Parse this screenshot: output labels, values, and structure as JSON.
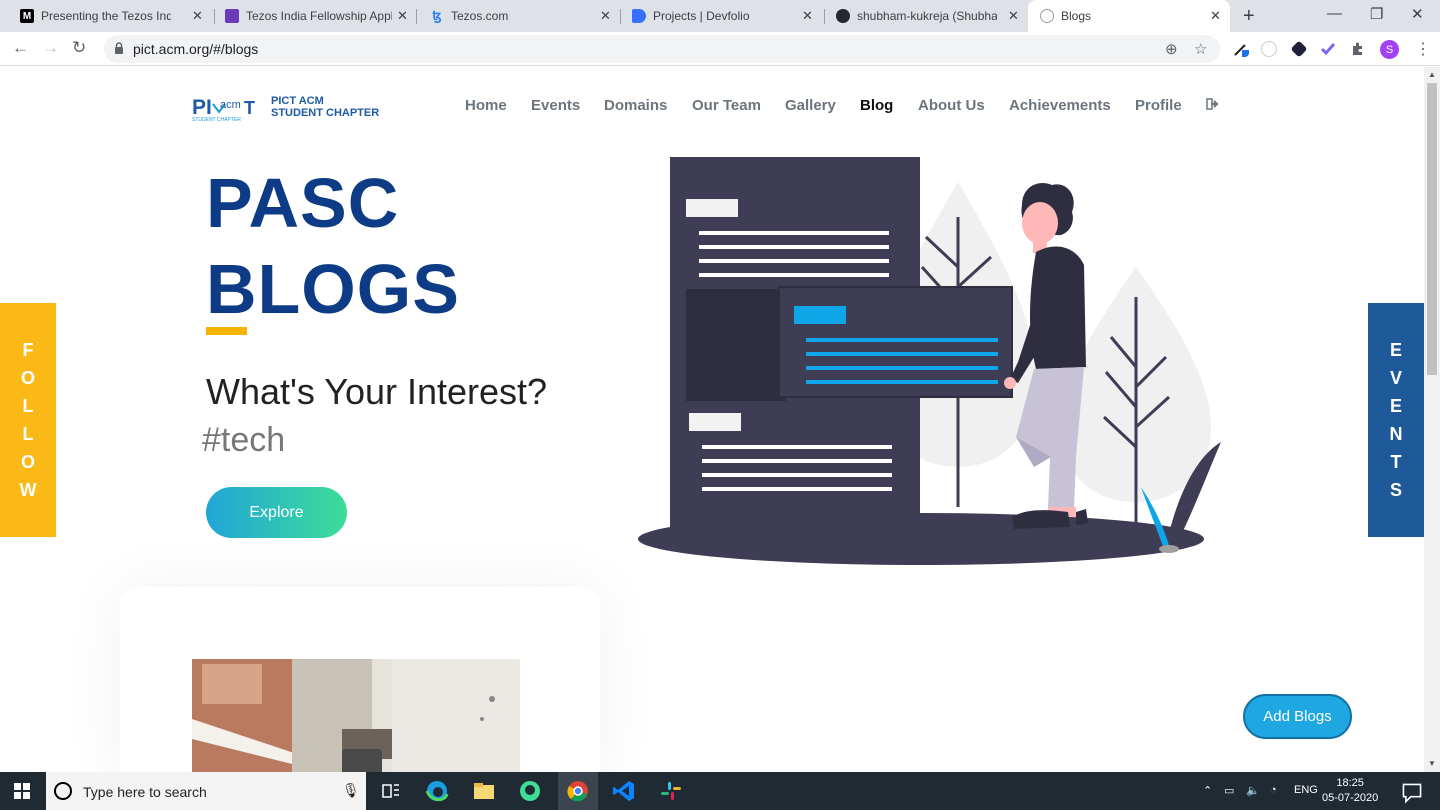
{
  "browser": {
    "tabs": [
      {
        "title": "Presenting the Tezos India Fe",
        "favicon": "M"
      },
      {
        "title": "Tezos India Fellowship Applic",
        "favicon": "forms-icon"
      },
      {
        "title": "Tezos.com",
        "favicon": "tezos-icon"
      },
      {
        "title": "Projects | Devfolio",
        "favicon": "devfolio-icon"
      },
      {
        "title": "shubham-kukreja (Shubham",
        "favicon": "github-icon"
      },
      {
        "title": "Blogs",
        "favicon": "globe-icon",
        "active": true
      }
    ],
    "url": "pict.acm.org/#/blogs",
    "profile_initial": "S"
  },
  "site": {
    "logo_text_line1": "PICT ACM",
    "logo_text_line2": "STUDENT CHAPTER",
    "nav": [
      {
        "label": "Home"
      },
      {
        "label": "Events"
      },
      {
        "label": "Domains"
      },
      {
        "label": "Our Team"
      },
      {
        "label": "Gallery"
      },
      {
        "label": "Blog",
        "active": true
      },
      {
        "label": "About Us"
      },
      {
        "label": "Achievements"
      },
      {
        "label": "Profile"
      }
    ],
    "hero": {
      "title_line1": "PASC",
      "title_line2": "BLOGS",
      "subtitle": "What's Your Interest?",
      "tag": "#tech",
      "explore_label": "Explore"
    },
    "side_left": [
      "F",
      "O",
      "L",
      "L",
      "O",
      "W"
    ],
    "side_right": [
      "E",
      "V",
      "E",
      "N",
      "T",
      "S"
    ],
    "add_blogs_label": "Add Blogs"
  },
  "taskbar": {
    "search_placeholder": "Type here to search",
    "language": "ENG",
    "time": "18:25",
    "date": "05-07-2020"
  },
  "colors": {
    "brand_blue": "#0d3b85",
    "accent_yellow": "#fbb917",
    "events_blue": "#1e5a99",
    "add_blogs": "#1ea7e1"
  }
}
